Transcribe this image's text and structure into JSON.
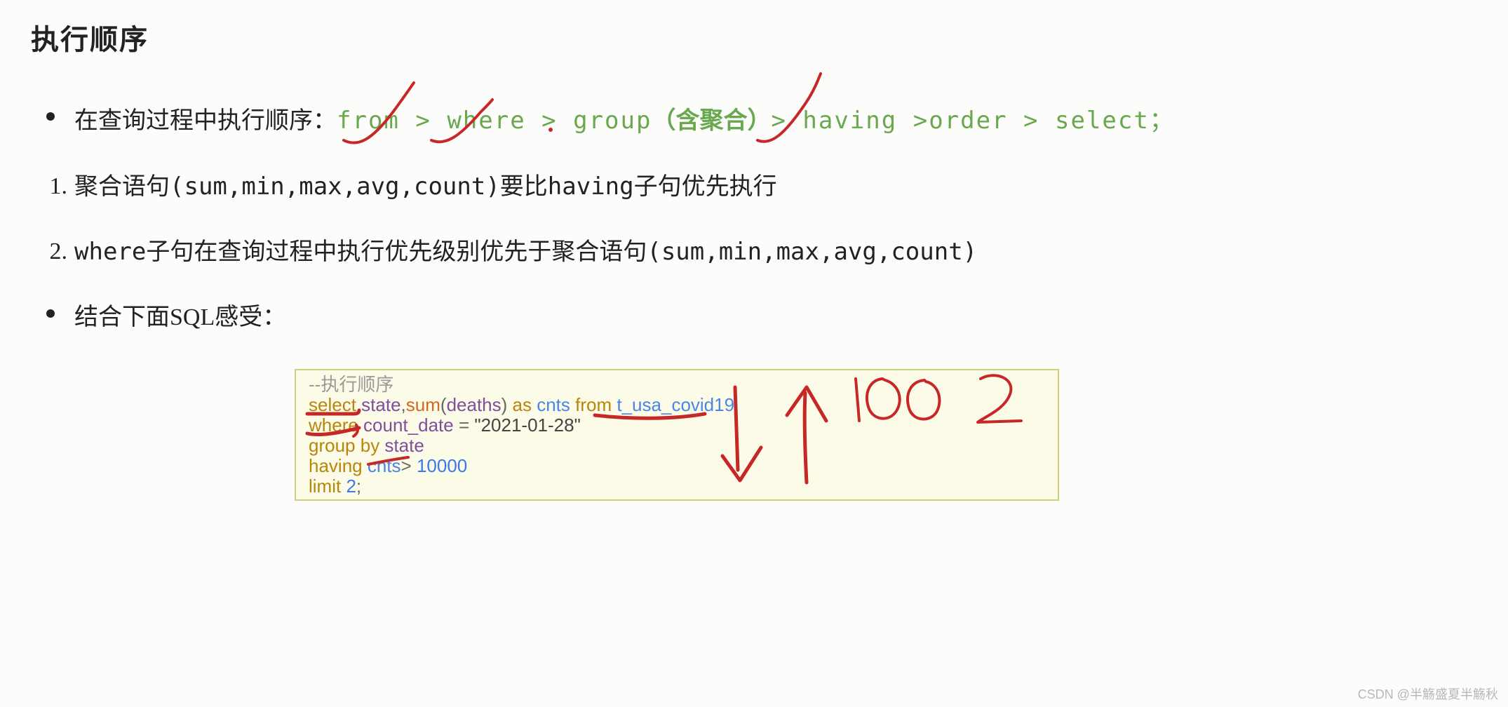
{
  "heading": "执行顺序",
  "bullets": {
    "intro_prefix": "在查询过程中执行顺序：",
    "order_tokens": {
      "from": "from",
      "gt1": " > ",
      "where": "where",
      "gt2": " > ",
      "group": "group",
      "paren_l": "（",
      "agg": "含聚合",
      "paren_r": "）",
      "gt3": "> ",
      "having": "having",
      "gt4": " >",
      "order": "order",
      "gt5": " > ",
      "select": "select；"
    },
    "item1_marker": "1.",
    "item1_text": "聚合语句(sum,min,max,avg,count)要比having子句优先执行",
    "item2_marker": "2.",
    "item2_text": "where子句在查询过程中执行优先级别优先于聚合语句(sum,min,max,avg,count)",
    "item3_text": "结合下面SQL感受："
  },
  "code": {
    "comment": "--执行顺序",
    "l1": {
      "select": "select ",
      "state": "state",
      "comma": ",",
      "sum": "sum",
      "lp": "(",
      "deaths": "deaths",
      "rp": ") ",
      "as": "as ",
      "cnts": "cnts ",
      "from": "from ",
      "table": "t_usa_covid19"
    },
    "l2": {
      "where": "where ",
      "col": "count_date",
      "eq": " = ",
      "val": "\"2021-01-28\""
    },
    "l3": {
      "group": "group ",
      "by": "by ",
      "state": "state"
    },
    "l4": {
      "having": "having ",
      "cnts": "cnts",
      "gt": "> ",
      "num": "10000"
    },
    "l5": {
      "limit": "limit ",
      "num": "2",
      "semi": ";"
    }
  },
  "watermark": "CSDN @半觞盛夏半觞秋"
}
